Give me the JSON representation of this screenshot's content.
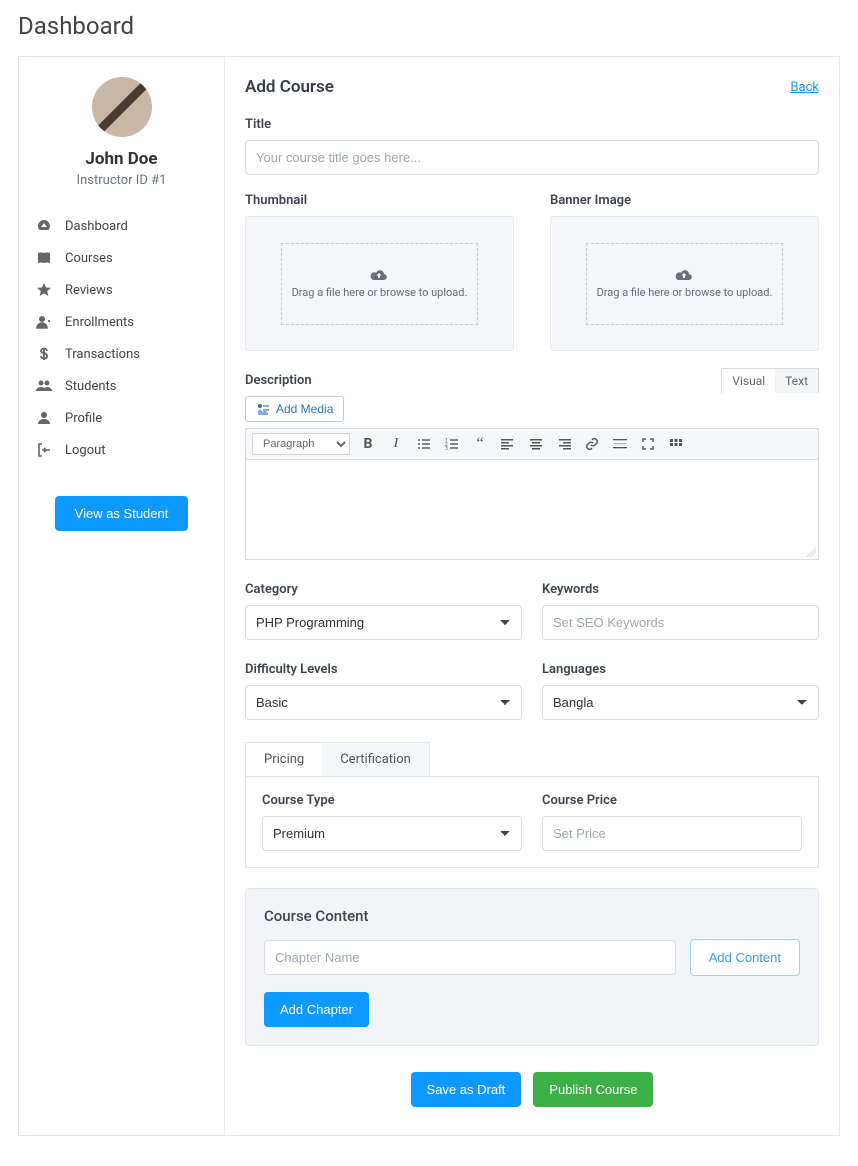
{
  "page_title": "Dashboard",
  "back_label": "Back",
  "profile": {
    "name": "John Doe",
    "meta": "Instructor ID #1"
  },
  "sidebar": {
    "items": [
      {
        "icon": "gauge-icon",
        "label": "Dashboard"
      },
      {
        "icon": "book-icon",
        "label": "Courses"
      },
      {
        "icon": "star-icon",
        "label": "Reviews"
      },
      {
        "icon": "user-plus-icon",
        "label": "Enrollments"
      },
      {
        "icon": "dollar-icon",
        "label": "Transactions"
      },
      {
        "icon": "users-icon",
        "label": "Students"
      },
      {
        "icon": "user-icon",
        "label": "Profile"
      },
      {
        "icon": "signout-icon",
        "label": "Logout"
      }
    ],
    "view_student": "View as Student"
  },
  "form": {
    "heading": "Add Course",
    "title_label": "Title",
    "title_placeholder": "Your course title goes here...",
    "thumbnail_label": "Thumbnail",
    "banner_label": "Banner Image",
    "dropzone_text": "Drag a file here or browse to upload.",
    "description_label": "Description",
    "add_media": "Add Media",
    "editor_tabs": {
      "visual": "Visual",
      "text": "Text"
    },
    "toolbar_format": "Paragraph",
    "category_label": "Category",
    "category_value": "PHP Programming",
    "keywords_label": "Keywords",
    "keywords_placeholder": "Set SEO Keywords",
    "difficulty_label": "Difficulty Levels",
    "difficulty_value": "Basic",
    "languages_label": "Languages",
    "languages_value": "Bangla",
    "tabs": {
      "pricing": "Pricing",
      "certification": "Certification"
    },
    "course_type_label": "Course Type",
    "course_type_value": "Premium",
    "course_price_label": "Course Price",
    "course_price_placeholder": "Set Price",
    "course_content_heading": "Course Content",
    "chapter_name_placeholder": "Chapter Name",
    "add_content": "Add Content",
    "add_chapter": "Add Chapter",
    "save_draft": "Save as Draft",
    "publish": "Publish Course"
  }
}
